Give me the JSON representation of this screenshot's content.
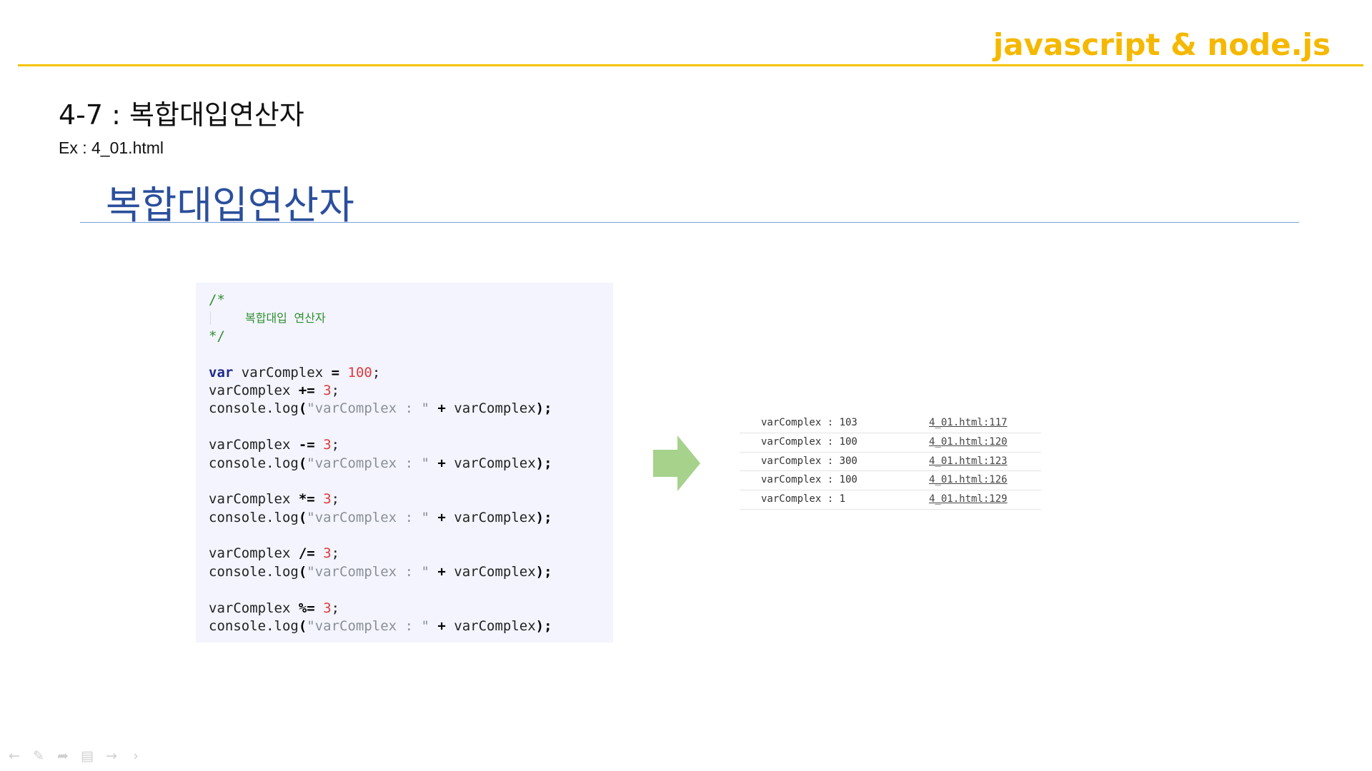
{
  "header": {
    "brand": "javascript & node.js",
    "brand_color": "#f5b800"
  },
  "slide": {
    "section_title": "4-7 : 복합대입연산자",
    "example_file": "Ex : 4_01.html",
    "heading": "복합대입연산자",
    "heading_color": "#2b4f9c"
  },
  "code": {
    "comment_open": "/*",
    "comment_text": "복합대입 연산자",
    "comment_close": "*/",
    "var_kw": "var",
    "identifier": "varComplex",
    "init_op": "=",
    "init_value": "100",
    "operand": "3",
    "log_prefix": "console.log",
    "log_string": "\"varComplex : \"",
    "log_plus": "+",
    "ops": [
      "+=",
      "-=",
      "*=",
      "/=",
      "%="
    ]
  },
  "console": {
    "rows": [
      {
        "message": "varComplex : 103",
        "source": "4_01.html:117"
      },
      {
        "message": "varComplex : 100",
        "source": "4_01.html:120"
      },
      {
        "message": "varComplex : 300",
        "source": "4_01.html:123"
      },
      {
        "message": "varComplex : 100",
        "source": "4_01.html:126"
      },
      {
        "message": "varComplex : 1",
        "source": "4_01.html:129"
      }
    ]
  },
  "controls": {
    "icons": [
      "back-arrow-icon",
      "pen-icon",
      "pointer-icon",
      "slides-icon",
      "forward-arrow-icon",
      "more-chevron-icon"
    ]
  }
}
